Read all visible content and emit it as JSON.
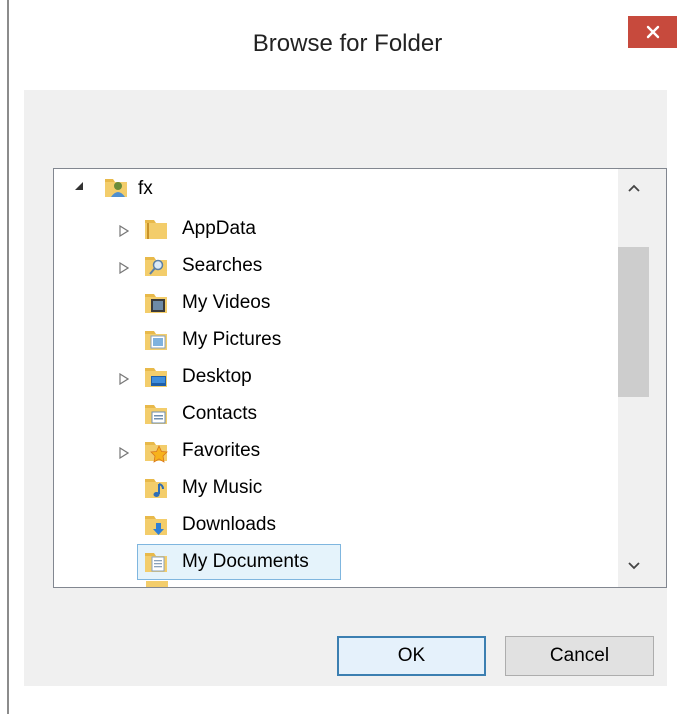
{
  "dialog": {
    "title": "Browse for Folder",
    "close_glyph": "✕"
  },
  "tree": {
    "root": {
      "label": "fx",
      "icon": "user-folder-icon",
      "expanded": true
    },
    "items": [
      {
        "label": "AppData",
        "icon": "folder-icon",
        "expandable": true
      },
      {
        "label": "Searches",
        "icon": "search-folder-icon",
        "expandable": true
      },
      {
        "label": "My Videos",
        "icon": "videos-folder-icon",
        "expandable": false
      },
      {
        "label": "My Pictures",
        "icon": "pictures-folder-icon",
        "expandable": false
      },
      {
        "label": "Desktop",
        "icon": "desktop-folder-icon",
        "expandable": true
      },
      {
        "label": "Contacts",
        "icon": "contacts-folder-icon",
        "expandable": false
      },
      {
        "label": "Favorites",
        "icon": "favorites-folder-icon",
        "expandable": true
      },
      {
        "label": "My Music",
        "icon": "music-folder-icon",
        "expandable": false
      },
      {
        "label": "Downloads",
        "icon": "downloads-folder-icon",
        "expandable": false
      },
      {
        "label": "My Documents",
        "icon": "documents-folder-icon",
        "expandable": false,
        "selected": true
      }
    ]
  },
  "buttons": {
    "ok": "OK",
    "cancel": "Cancel"
  },
  "colors": {
    "close_button": "#c74a3d",
    "selection_border": "#7fb6df",
    "selection_fill": "#e5f3fb",
    "folder": "#e8b94a"
  }
}
